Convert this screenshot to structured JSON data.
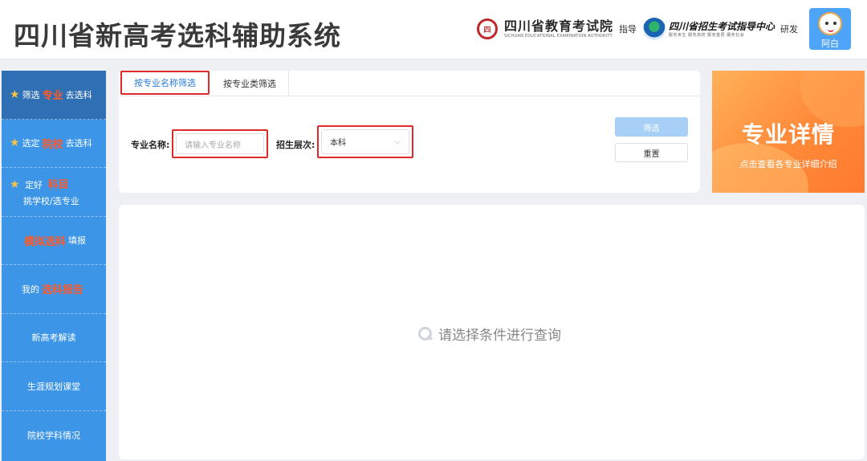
{
  "header": {
    "title": "四川省新高考选科辅助系统",
    "org1": {
      "logo_text": "四",
      "name": "四川省教育考试院",
      "sub": "SICHUAN EDUCATIONAL EXAMINATION AUTHORITY"
    },
    "guide_label": "指导",
    "org2": {
      "name": "四川省招生考试指导中心",
      "sub": "服务考生 服务高校 服务基层 服务社会"
    },
    "dev_label": "研发",
    "user_name": "阿白"
  },
  "sidebar": {
    "items": [
      {
        "pre": "筛选",
        "hl": "专业",
        "post": "去选科"
      },
      {
        "pre": "选定",
        "hl": "院校",
        "post": "去选科"
      },
      {
        "pre": "定好",
        "hl": "科目",
        "line2": "挑学校/选专业"
      },
      {
        "pre": "",
        "hl": "模拟选科",
        "post": "填报"
      },
      {
        "pre": "我的",
        "hl": "选科报告",
        "post": ""
      },
      {
        "label": "新高考解读"
      },
      {
        "label": "生涯规划课堂"
      },
      {
        "label": "院校学科情况"
      }
    ]
  },
  "filter": {
    "tabs": [
      "按专业名称筛选",
      "按专业类筛选"
    ],
    "name_label": "专业名称:",
    "name_placeholder": "请输入专业名称",
    "level_label": "招生层次:",
    "level_value": "本科",
    "filter_button": "筛选",
    "reset_button": "重置"
  },
  "promo": {
    "title": "专业详情",
    "subtitle": "点击查看各专业详细介绍"
  },
  "results": {
    "empty_message": "请选择条件进行查询"
  }
}
